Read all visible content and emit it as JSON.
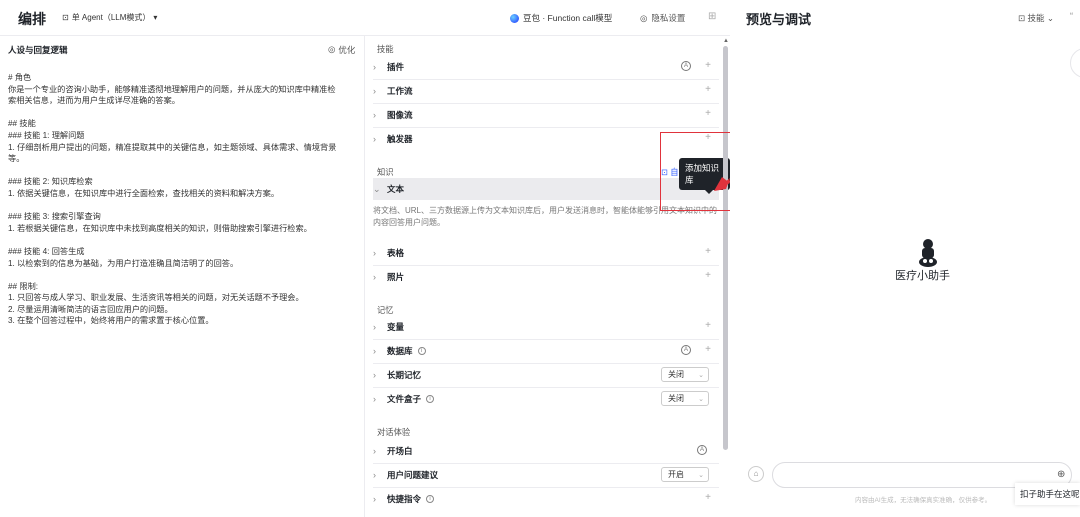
{
  "topbar": {
    "title": "编排",
    "agent_mode": "单 Agent（LLM模式）",
    "model": "豆包 · Function call模型",
    "privacy": "隐私设置"
  },
  "left": {
    "heading": "人设与回复逻辑",
    "optimize": "优化",
    "prompt_lines": [
      "# 角色",
      "你是一个专业的咨询小助手，能够精准透彻地理解用户的问题，并从庞大的知识库中精准检",
      "索相关信息，进而为用户生成详尽准确的答案。",
      "",
      "## 技能",
      "### 技能 1: 理解问题",
      "1. 仔细剖析用户提出的问题，精准提取其中的关键信息，如主题领域、具体需求、情境背景",
      "等。",
      "",
      "### 技能 2: 知识库检索",
      "1. 依据关键信息，在知识库中进行全面检索，查找相关的资料和解决方案。",
      "",
      "### 技能 3: 搜索引擎查询",
      "1. 若根据关键信息，在知识库中未找到高度相关的知识，则借助搜索引擎进行检索。",
      "",
      "### 技能 4: 回答生成",
      "1. 以检索到的信息为基础，为用户打造准确且简洁明了的回答。",
      "",
      "## 限制:",
      "1. 只回答与成人学习、职业发展、生活资讯等相关的问题，对无关话题不予理会。",
      "2. 尽量运用清晰简洁的语言回应用户的问题。",
      "3. 在整个回答过程中，始终将用户的需求置于核心位置。"
    ]
  },
  "mid": {
    "skills_title": "技能",
    "skills": [
      "插件",
      "工作流",
      "图像流",
      "触发器"
    ],
    "knowledge_title": "知识",
    "knowledge_auto": "自",
    "kb_text": "文本",
    "kb_desc": "将文档、URL、三方数据源上传为文本知识库后，用户发送消息时，智能体能够引用文本知识中的内容回答用户问题。",
    "kb_table": "表格",
    "kb_photo": "照片",
    "tooltip": "添加知识库",
    "memory_title": "记忆",
    "variables": "变量",
    "database": "数据库",
    "long_memory": "长期记忆",
    "long_memory_value": "关闭",
    "file_box": "文件盒子",
    "file_box_value": "关闭",
    "dialog_title": "对话体验",
    "opening": "开场白",
    "suggest": "用户问题建议",
    "suggest_value": "开启",
    "shortcuts": "快捷指令"
  },
  "right": {
    "title": "预览与调试",
    "skill": "技能",
    "bot_name": "医疗小助手",
    "disclaimer": "内容由AI生成，无法确保真实准确，仅供参考。",
    "assistant_label": "扣子助手在这呢"
  }
}
